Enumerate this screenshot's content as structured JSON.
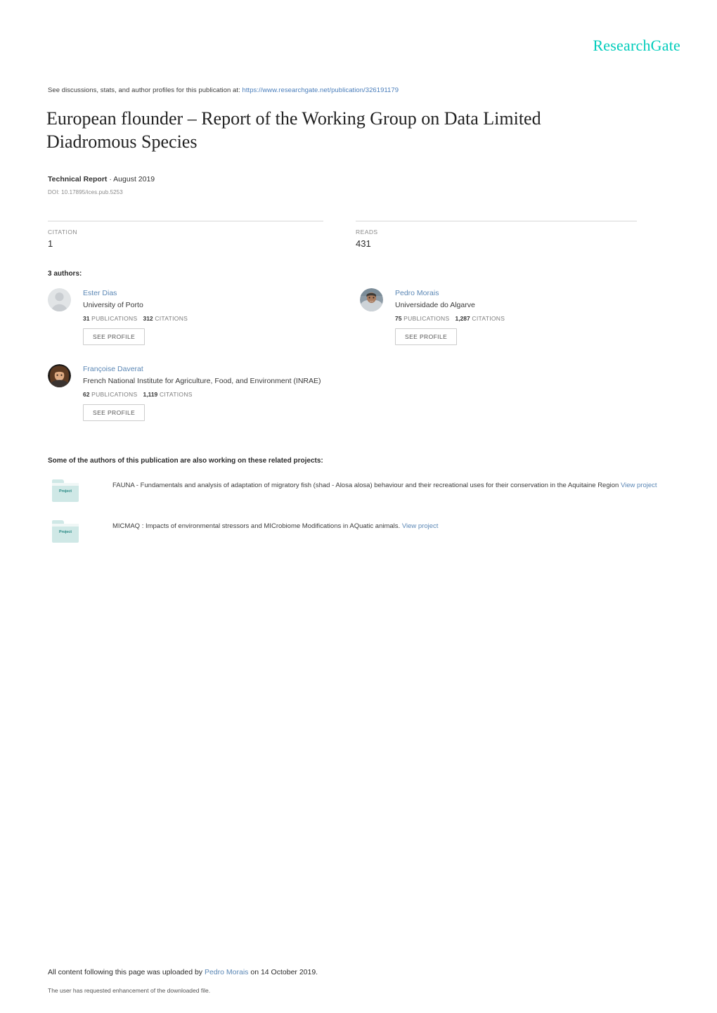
{
  "header": {
    "logo_text": "ResearchGate",
    "logo_color": "#00ccbb",
    "see_discussions_prefix": "See discussions, stats, and author profiles for this publication at:",
    "publication_url": "https://www.researchgate.net/publication/326191179"
  },
  "publication": {
    "title": "European flounder – Report of the Working Group on Data Limited Diadromous Species",
    "type": "Technical Report",
    "separator": "·",
    "date": "August 2019",
    "doi": "DOI: 10.17895/ices.pub.5253"
  },
  "stats": {
    "citation_label": "CITATION",
    "citation_value": "1",
    "reads_label": "READS",
    "reads_value": "431"
  },
  "authors_section": {
    "count_label": "3 authors:",
    "see_profile_label": "SEE PROFILE",
    "publications_label": "PUBLICATIONS",
    "citations_label": "CITATIONS",
    "authors": [
      {
        "name": "Ester Dias",
        "affiliation": "University of Porto",
        "publications": "31",
        "citations": "312",
        "avatar_type": "placeholder"
      },
      {
        "name": "Pedro Morais",
        "affiliation": "Universidade do Algarve",
        "publications": "75",
        "citations": "1,287",
        "avatar_type": "photo"
      },
      {
        "name": "Françoise Daverat",
        "affiliation": "French National Institute for Agriculture, Food, and Environment (INRAE)",
        "publications": "62",
        "citations": "1,119",
        "avatar_type": "photo"
      }
    ]
  },
  "projects_section": {
    "heading": "Some of the authors of this publication are also working on these related projects:",
    "icon_label": "Project",
    "view_project_label": "View project",
    "projects": [
      {
        "description": "FAUNA - Fundamentals and analysis of adaptation of migratory fish (shad - Alosa alosa) behaviour and their recreational uses for their conservation in the Aquitaine Region"
      },
      {
        "description": "MICMAQ : Impacts of environmental stressors and MICrobiome Modifications in AQuatic animals."
      }
    ]
  },
  "footer": {
    "upload_prefix": "All content following this page was uploaded by",
    "uploader": "Pedro Morais",
    "upload_suffix": "on 14 October 2019.",
    "enhancement_note": "The user has requested enhancement of the downloaded file."
  }
}
